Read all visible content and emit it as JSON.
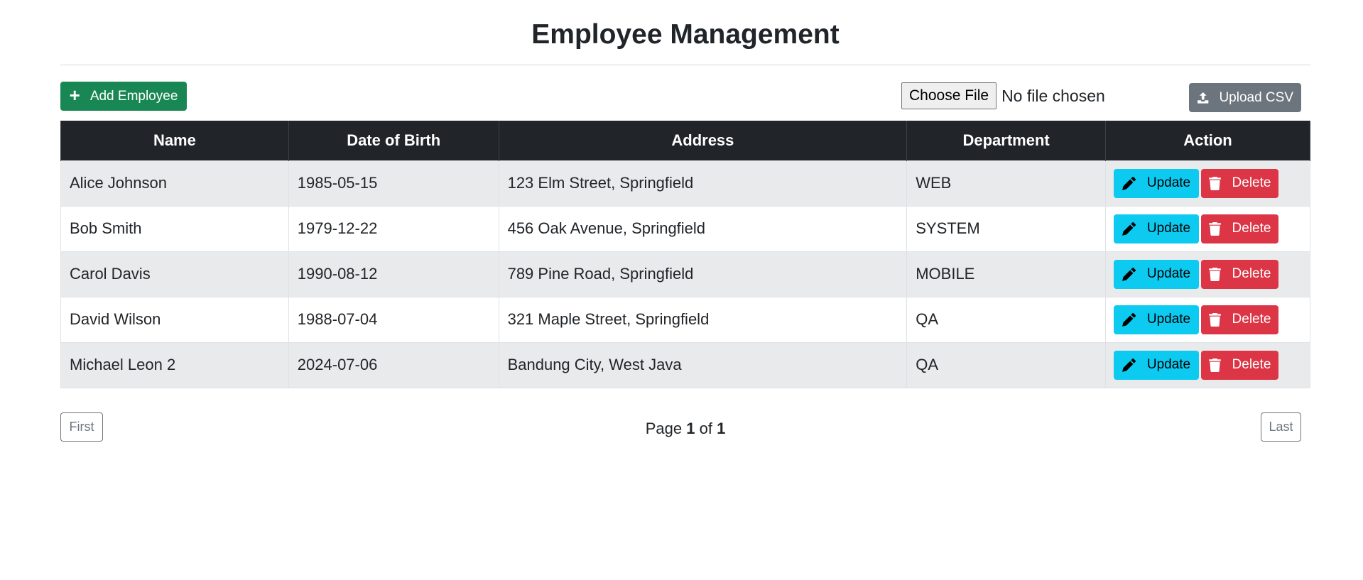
{
  "page": {
    "title": "Employee Management"
  },
  "toolbar": {
    "add_label": "Add Employee",
    "file_button_label": "Choose File",
    "file_status": "No file chosen",
    "upload_label": "Upload CSV"
  },
  "table": {
    "columns": [
      "Name",
      "Date of Birth",
      "Address",
      "Department",
      "Action"
    ],
    "rows": [
      {
        "name": "Alice Johnson",
        "dob": "1985-05-15",
        "address": "123 Elm Street, Springfield",
        "department": "WEB"
      },
      {
        "name": "Bob Smith",
        "dob": "1979-12-22",
        "address": "456 Oak Avenue, Springfield",
        "department": "SYSTEM"
      },
      {
        "name": "Carol Davis",
        "dob": "1990-08-12",
        "address": "789 Pine Road, Springfield",
        "department": "MOBILE"
      },
      {
        "name": "David Wilson",
        "dob": "1988-07-04",
        "address": "321 Maple Street, Springfield",
        "department": "QA"
      },
      {
        "name": "Michael Leon 2",
        "dob": "2024-07-06",
        "address": "Bandung City, West Java",
        "department": "QA"
      }
    ],
    "update_label": "Update",
    "delete_label": "Delete"
  },
  "pagination": {
    "first_label": "First",
    "last_label": "Last",
    "page_prefix": "Page",
    "current_page": "1",
    "of_label": "of",
    "total_pages": "1"
  },
  "icons": {
    "add": "plus-icon",
    "upload": "upload-icon",
    "update": "pencil-icon",
    "delete": "trash-icon"
  },
  "colors": {
    "add_button": "#198754",
    "upload_button": "#6c757d",
    "update_button": "#0dcaf0",
    "delete_button": "#dc3545",
    "table_header": "#212529"
  }
}
